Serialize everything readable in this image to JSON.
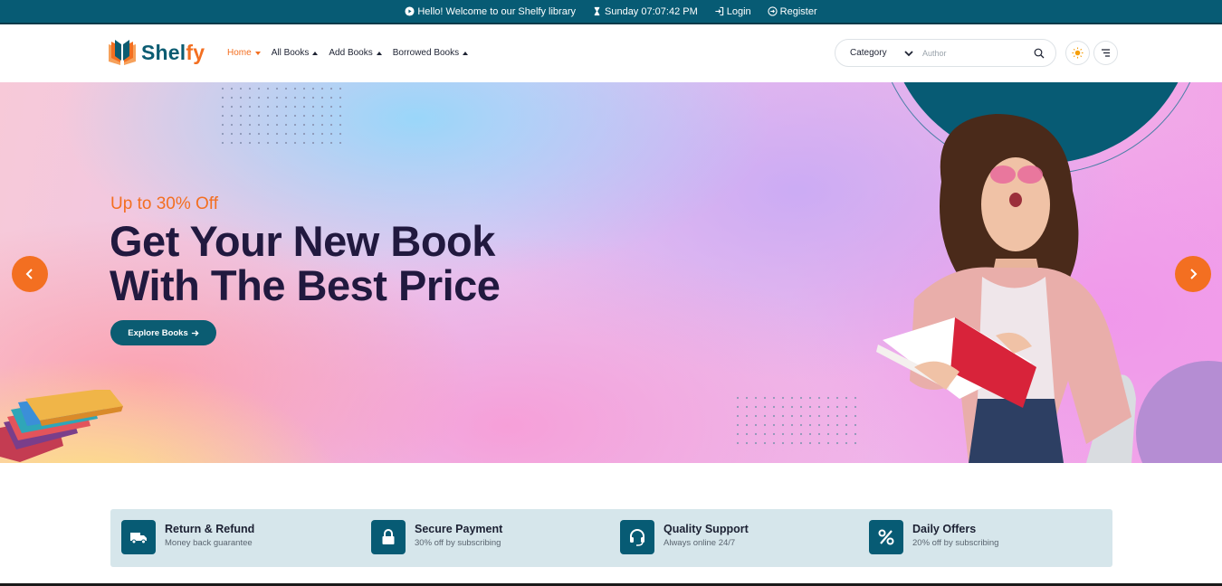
{
  "topbar": {
    "welcome": "Hello! Welcome to our Shelfy library",
    "datetime": "Sunday 07:07:42 PM",
    "login": "Login",
    "register": "Register"
  },
  "logo": {
    "prefix": "Shel",
    "suffix": "fy"
  },
  "menu": {
    "items": [
      {
        "label": "Home"
      },
      {
        "label": "All Books"
      },
      {
        "label": "Add Books"
      },
      {
        "label": "Borrowed Books"
      }
    ]
  },
  "search": {
    "category": "Category",
    "author_placeholder": "Author"
  },
  "hero": {
    "subtitle": "Up to 30% Off",
    "title_line1": "Get Your New Book",
    "title_line2": "With The Best Price",
    "button": "Explore Books"
  },
  "features": [
    {
      "title": "Return & Refund",
      "desc": "Money back guarantee",
      "icon": "truck-icon"
    },
    {
      "title": "Secure Payment",
      "desc": "30% off by subscribing",
      "icon": "lock-icon"
    },
    {
      "title": "Quality Support",
      "desc": "Always online 24/7",
      "icon": "headset-icon"
    },
    {
      "title": "Daily Offers",
      "desc": "20% off by subscribing",
      "icon": "percent-icon"
    }
  ],
  "colors": {
    "primary": "#075b74",
    "accent": "#f36f21",
    "heading": "#21193f"
  }
}
